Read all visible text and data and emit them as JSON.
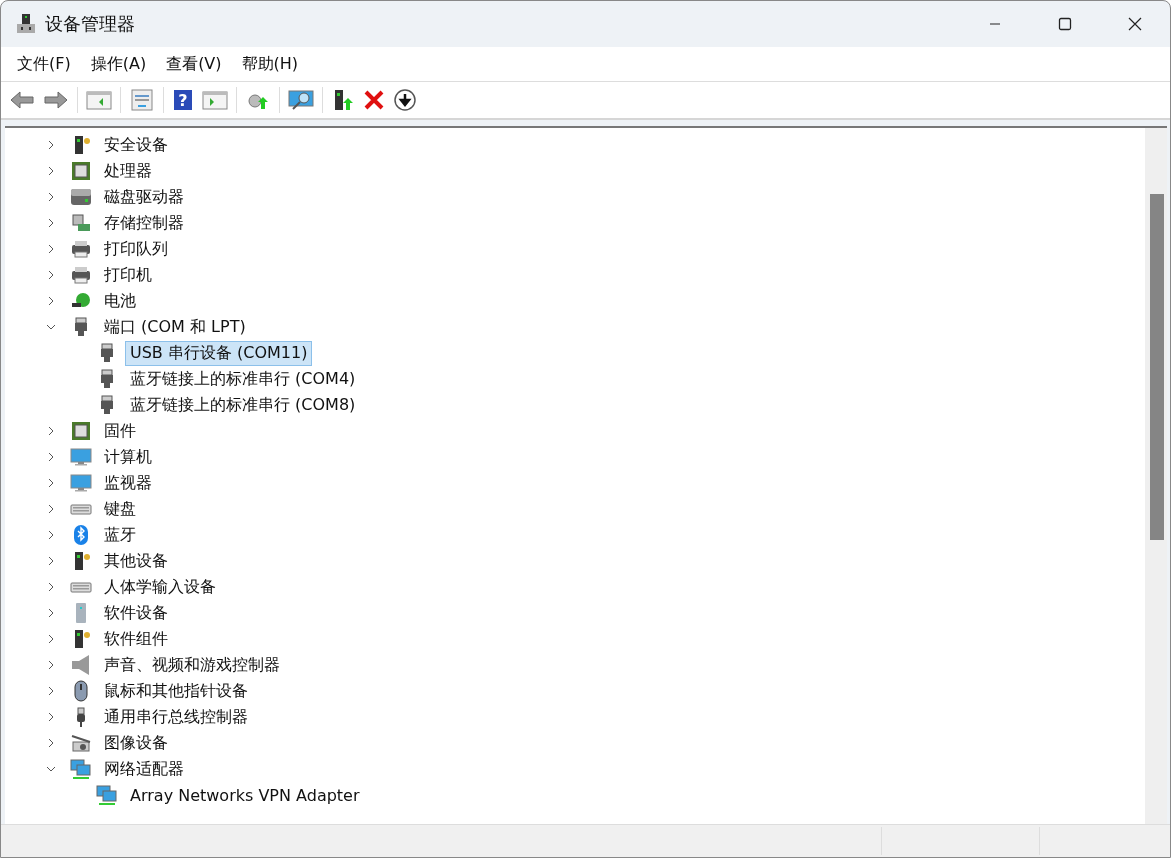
{
  "window": {
    "title": "设备管理器"
  },
  "menu": [
    "文件(F)",
    "操作(A)",
    "查看(V)",
    "帮助(H)"
  ],
  "toolbar": {
    "help_glyph": "?"
  },
  "tree": [
    {
      "label": "安全设备",
      "expanded": false
    },
    {
      "label": "处理器",
      "expanded": false
    },
    {
      "label": "磁盘驱动器",
      "expanded": false
    },
    {
      "label": "存储控制器",
      "expanded": false
    },
    {
      "label": "打印队列",
      "expanded": false
    },
    {
      "label": "打印机",
      "expanded": false
    },
    {
      "label": "电池",
      "expanded": false
    },
    {
      "label": "端口 (COM 和 LPT)",
      "expanded": true,
      "children": [
        {
          "label": "USB 串行设备 (COM11)",
          "selected": true
        },
        {
          "label": "蓝牙链接上的标准串行 (COM4)",
          "selected": false
        },
        {
          "label": "蓝牙链接上的标准串行 (COM8)",
          "selected": false
        }
      ]
    },
    {
      "label": "固件",
      "expanded": false
    },
    {
      "label": "计算机",
      "expanded": false
    },
    {
      "label": "监视器",
      "expanded": false
    },
    {
      "label": "键盘",
      "expanded": false
    },
    {
      "label": "蓝牙",
      "expanded": false
    },
    {
      "label": "其他设备",
      "expanded": false
    },
    {
      "label": "人体学输入设备",
      "expanded": false
    },
    {
      "label": "软件设备",
      "expanded": false
    },
    {
      "label": "软件组件",
      "expanded": false
    },
    {
      "label": "声音、视频和游戏控制器",
      "expanded": false
    },
    {
      "label": "鼠标和其他指针设备",
      "expanded": false
    },
    {
      "label": "通用串行总线控制器",
      "expanded": false
    },
    {
      "label": "图像设备",
      "expanded": false
    },
    {
      "label": "网络适配器",
      "expanded": true,
      "children": [
        {
          "label": "Array Networks VPN Adapter",
          "selected": false
        }
      ]
    }
  ]
}
